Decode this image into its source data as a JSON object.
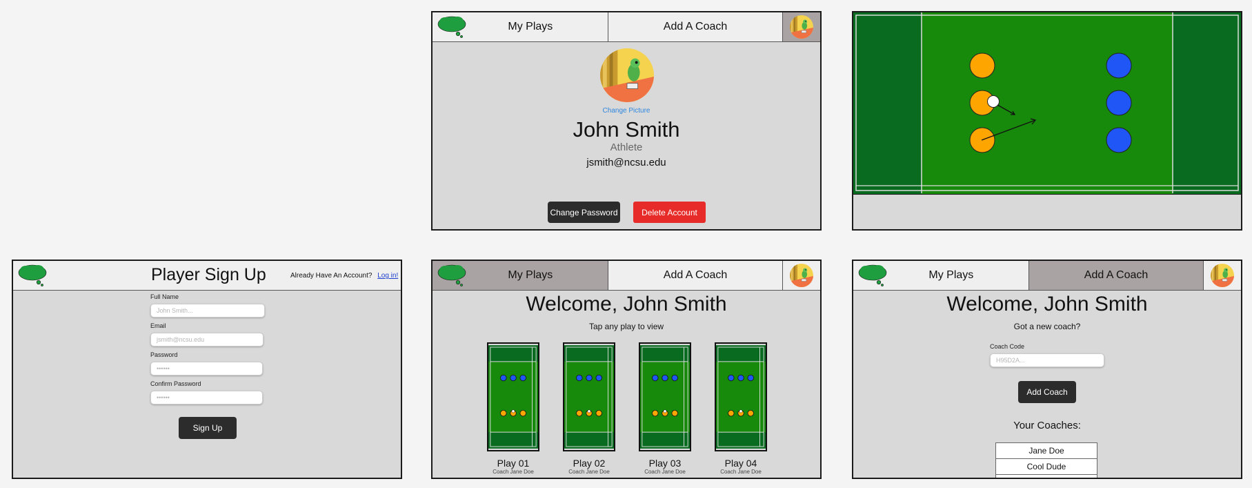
{
  "profile": {
    "nav": {
      "tab_plays": "My Plays",
      "tab_add_coach": "Add A Coach"
    },
    "change_picture": "Change Picture",
    "name": "John Smith",
    "role": "Athlete",
    "email": "jsmith@ncsu.edu",
    "change_password": "Change Password",
    "delete_account": "Delete Account"
  },
  "signup": {
    "title": "Player Sign Up",
    "already": "Already Have An Account?",
    "login_link": "Log in!",
    "full_name_label": "Full Name",
    "full_name_placeholder": "John Smith...",
    "email_label": "Email",
    "email_placeholder": "jsmith@ncsu.edu",
    "password_label": "Password",
    "password_placeholder": "••••••",
    "confirm_label": "Confirm Password",
    "confirm_placeholder": "••••••",
    "submit": "Sign Up"
  },
  "plays": {
    "nav": {
      "tab_plays": "My Plays",
      "tab_add_coach": "Add A Coach"
    },
    "welcome": "Welcome, John Smith",
    "subtitle": "Tap any play to view",
    "items": [
      {
        "title": "Play 01",
        "coach": "Coach Jane Doe"
      },
      {
        "title": "Play 02",
        "coach": "Coach Jane Doe"
      },
      {
        "title": "Play 03",
        "coach": "Coach Jane Doe"
      },
      {
        "title": "Play 04",
        "coach": "Coach Jane Doe"
      }
    ]
  },
  "addcoach": {
    "nav": {
      "tab_plays": "My Plays",
      "tab_add_coach": "Add A Coach"
    },
    "welcome": "Welcome, John Smith",
    "subtitle": "Got a new coach?",
    "code_label": "Coach Code",
    "code_placeholder": "H95D2A...",
    "add_button": "Add Coach",
    "your_coaches": "Your Coaches:",
    "coaches": [
      "Jane Doe",
      "Cool Dude"
    ]
  },
  "colors": {
    "field_dark": "#086b1f",
    "field_light": "#17890b",
    "team_orange": "#ffa500",
    "team_blue": "#1f56f5",
    "danger": "#e62b28",
    "link": "#2e86de"
  }
}
